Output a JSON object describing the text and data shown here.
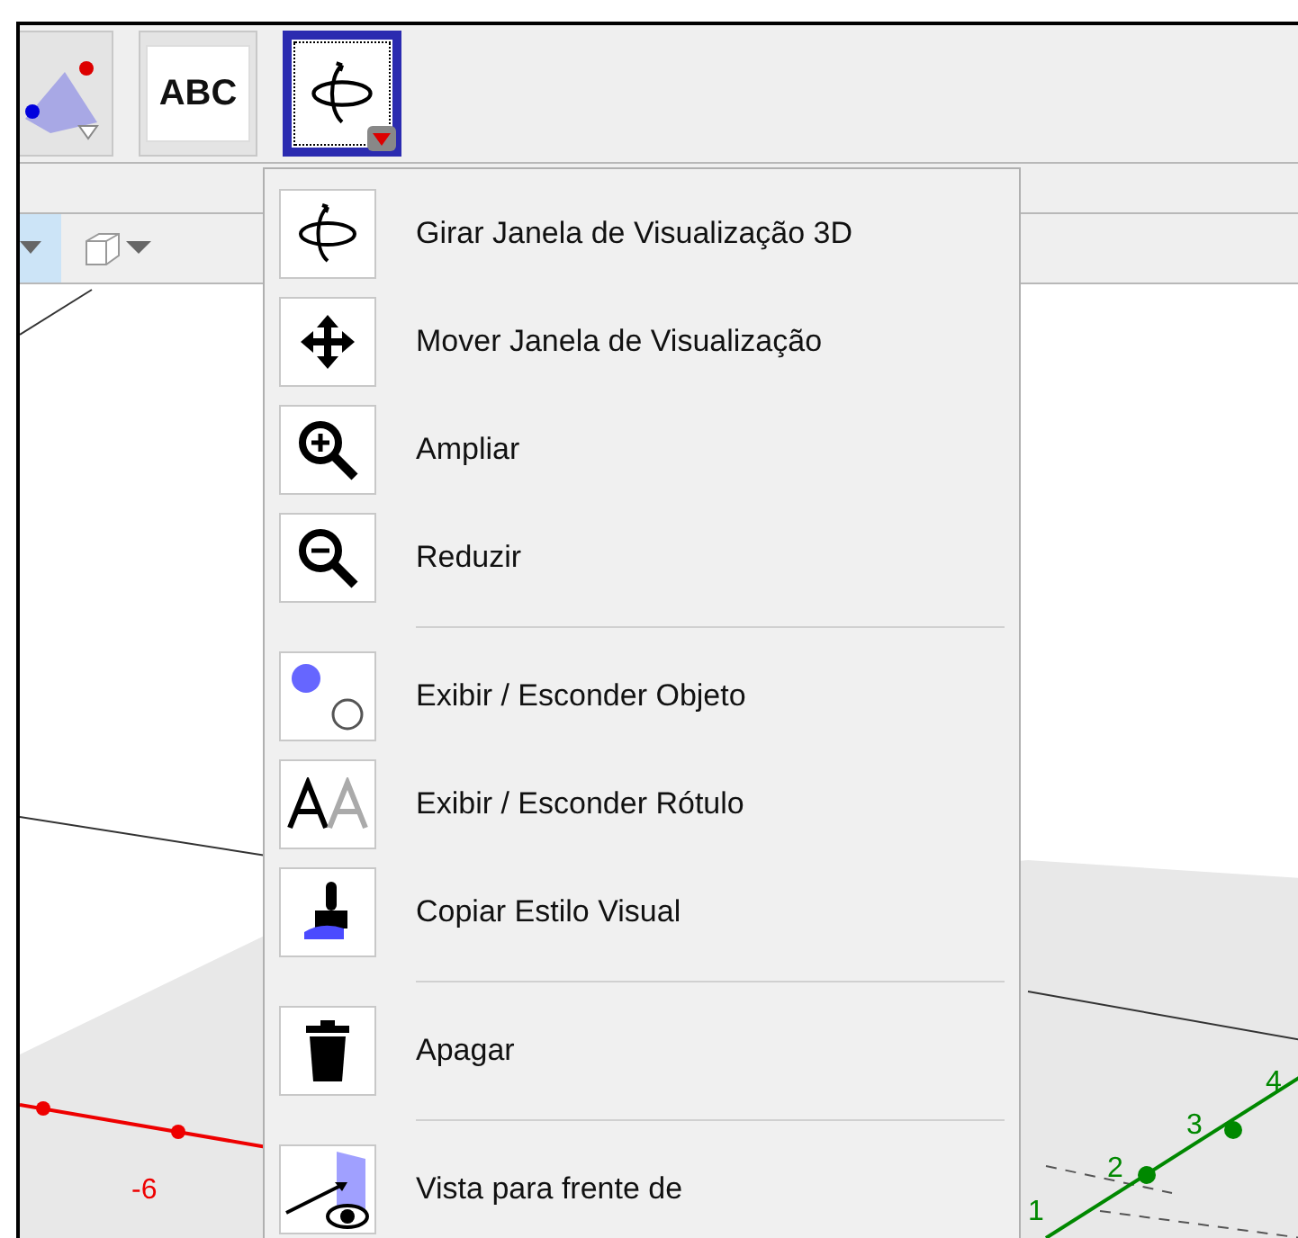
{
  "toolbar": {
    "buttons": [
      {
        "selected": false
      },
      {
        "label": "ABC",
        "selected": false
      },
      {
        "selected": true
      }
    ]
  },
  "menu": {
    "groups": [
      [
        {
          "label": "Girar Janela de Visualização 3D"
        },
        {
          "label": "Mover Janela de Visualização"
        },
        {
          "label": "Ampliar"
        },
        {
          "label": "Reduzir"
        }
      ],
      [
        {
          "label": "Exibir / Esconder Objeto"
        },
        {
          "label": "Exibir / Esconder Rótulo"
        },
        {
          "label": "Copiar Estilo Visual"
        }
      ],
      [
        {
          "label": "Apagar"
        }
      ],
      [
        {
          "label": "Vista para frente de"
        }
      ]
    ]
  },
  "canvas": {
    "red_axis_labels": [
      "-6"
    ],
    "green_axis_labels": [
      "1",
      "2",
      "3",
      "4"
    ]
  }
}
